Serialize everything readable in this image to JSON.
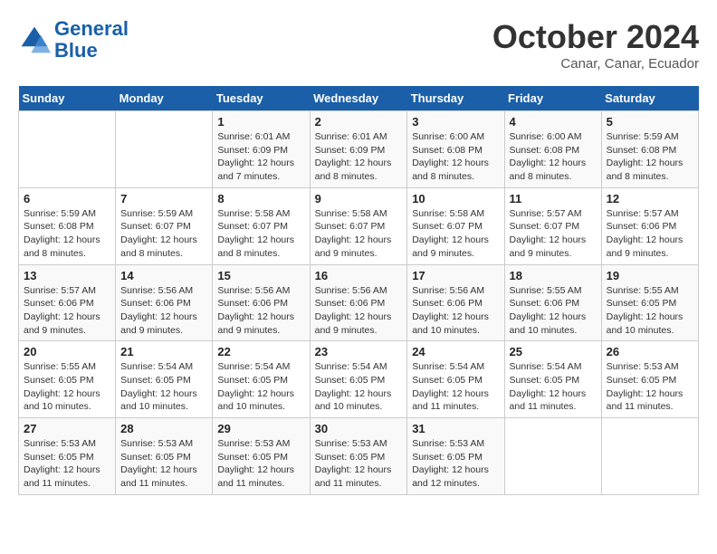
{
  "header": {
    "logo_line1": "General",
    "logo_line2": "Blue",
    "month": "October 2024",
    "location": "Canar, Canar, Ecuador"
  },
  "weekdays": [
    "Sunday",
    "Monday",
    "Tuesday",
    "Wednesday",
    "Thursday",
    "Friday",
    "Saturday"
  ],
  "weeks": [
    [
      {
        "day": "",
        "info": ""
      },
      {
        "day": "",
        "info": ""
      },
      {
        "day": "1",
        "info": "Sunrise: 6:01 AM\nSunset: 6:09 PM\nDaylight: 12 hours and 7 minutes."
      },
      {
        "day": "2",
        "info": "Sunrise: 6:01 AM\nSunset: 6:09 PM\nDaylight: 12 hours and 8 minutes."
      },
      {
        "day": "3",
        "info": "Sunrise: 6:00 AM\nSunset: 6:08 PM\nDaylight: 12 hours and 8 minutes."
      },
      {
        "day": "4",
        "info": "Sunrise: 6:00 AM\nSunset: 6:08 PM\nDaylight: 12 hours and 8 minutes."
      },
      {
        "day": "5",
        "info": "Sunrise: 5:59 AM\nSunset: 6:08 PM\nDaylight: 12 hours and 8 minutes."
      }
    ],
    [
      {
        "day": "6",
        "info": "Sunrise: 5:59 AM\nSunset: 6:08 PM\nDaylight: 12 hours and 8 minutes."
      },
      {
        "day": "7",
        "info": "Sunrise: 5:59 AM\nSunset: 6:07 PM\nDaylight: 12 hours and 8 minutes."
      },
      {
        "day": "8",
        "info": "Sunrise: 5:58 AM\nSunset: 6:07 PM\nDaylight: 12 hours and 8 minutes."
      },
      {
        "day": "9",
        "info": "Sunrise: 5:58 AM\nSunset: 6:07 PM\nDaylight: 12 hours and 9 minutes."
      },
      {
        "day": "10",
        "info": "Sunrise: 5:58 AM\nSunset: 6:07 PM\nDaylight: 12 hours and 9 minutes."
      },
      {
        "day": "11",
        "info": "Sunrise: 5:57 AM\nSunset: 6:07 PM\nDaylight: 12 hours and 9 minutes."
      },
      {
        "day": "12",
        "info": "Sunrise: 5:57 AM\nSunset: 6:06 PM\nDaylight: 12 hours and 9 minutes."
      }
    ],
    [
      {
        "day": "13",
        "info": "Sunrise: 5:57 AM\nSunset: 6:06 PM\nDaylight: 12 hours and 9 minutes."
      },
      {
        "day": "14",
        "info": "Sunrise: 5:56 AM\nSunset: 6:06 PM\nDaylight: 12 hours and 9 minutes."
      },
      {
        "day": "15",
        "info": "Sunrise: 5:56 AM\nSunset: 6:06 PM\nDaylight: 12 hours and 9 minutes."
      },
      {
        "day": "16",
        "info": "Sunrise: 5:56 AM\nSunset: 6:06 PM\nDaylight: 12 hours and 9 minutes."
      },
      {
        "day": "17",
        "info": "Sunrise: 5:56 AM\nSunset: 6:06 PM\nDaylight: 12 hours and 10 minutes."
      },
      {
        "day": "18",
        "info": "Sunrise: 5:55 AM\nSunset: 6:06 PM\nDaylight: 12 hours and 10 minutes."
      },
      {
        "day": "19",
        "info": "Sunrise: 5:55 AM\nSunset: 6:05 PM\nDaylight: 12 hours and 10 minutes."
      }
    ],
    [
      {
        "day": "20",
        "info": "Sunrise: 5:55 AM\nSunset: 6:05 PM\nDaylight: 12 hours and 10 minutes."
      },
      {
        "day": "21",
        "info": "Sunrise: 5:54 AM\nSunset: 6:05 PM\nDaylight: 12 hours and 10 minutes."
      },
      {
        "day": "22",
        "info": "Sunrise: 5:54 AM\nSunset: 6:05 PM\nDaylight: 12 hours and 10 minutes."
      },
      {
        "day": "23",
        "info": "Sunrise: 5:54 AM\nSunset: 6:05 PM\nDaylight: 12 hours and 10 minutes."
      },
      {
        "day": "24",
        "info": "Sunrise: 5:54 AM\nSunset: 6:05 PM\nDaylight: 12 hours and 11 minutes."
      },
      {
        "day": "25",
        "info": "Sunrise: 5:54 AM\nSunset: 6:05 PM\nDaylight: 12 hours and 11 minutes."
      },
      {
        "day": "26",
        "info": "Sunrise: 5:53 AM\nSunset: 6:05 PM\nDaylight: 12 hours and 11 minutes."
      }
    ],
    [
      {
        "day": "27",
        "info": "Sunrise: 5:53 AM\nSunset: 6:05 PM\nDaylight: 12 hours and 11 minutes."
      },
      {
        "day": "28",
        "info": "Sunrise: 5:53 AM\nSunset: 6:05 PM\nDaylight: 12 hours and 11 minutes."
      },
      {
        "day": "29",
        "info": "Sunrise: 5:53 AM\nSunset: 6:05 PM\nDaylight: 12 hours and 11 minutes."
      },
      {
        "day": "30",
        "info": "Sunrise: 5:53 AM\nSunset: 6:05 PM\nDaylight: 12 hours and 11 minutes."
      },
      {
        "day": "31",
        "info": "Sunrise: 5:53 AM\nSunset: 6:05 PM\nDaylight: 12 hours and 12 minutes."
      },
      {
        "day": "",
        "info": ""
      },
      {
        "day": "",
        "info": ""
      }
    ]
  ]
}
